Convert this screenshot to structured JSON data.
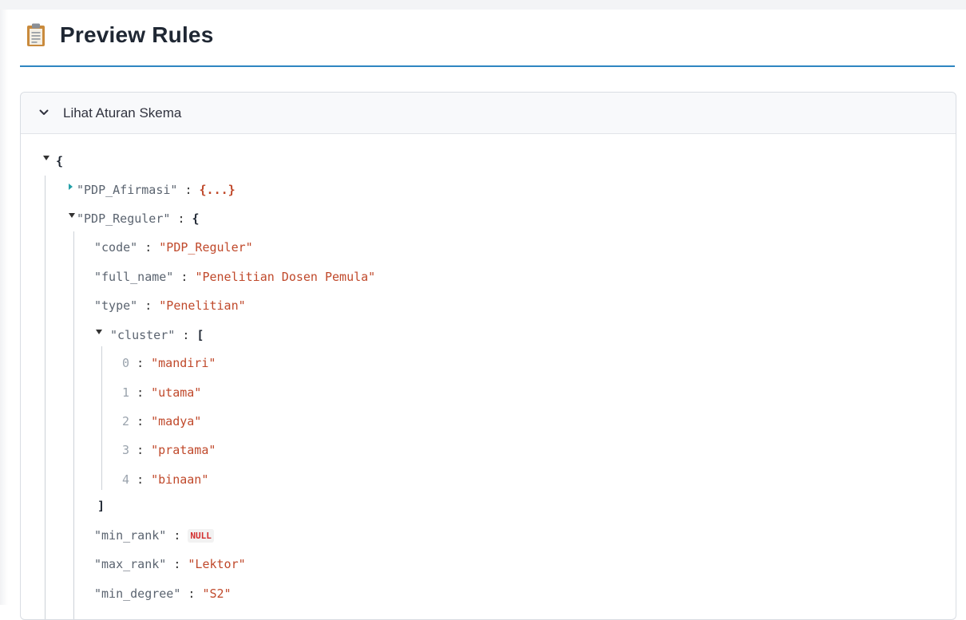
{
  "page": {
    "title": "Preview Rules",
    "icon": "clipboard-icon"
  },
  "expander": {
    "label": "Lihat Aturan Skema",
    "icon": "chevron-down-icon"
  },
  "json": {
    "open_brace": "{",
    "afirmasi_key": "\"PDP_Afirmasi\"",
    "afirmasi_collapsed": "{...}",
    "reguler_key": "\"PDP_Reguler\"",
    "reguler_open": "{",
    "colon": ":",
    "code_key": "\"code\"",
    "code_val": "\"PDP_Reguler\"",
    "full_name_key": "\"full_name\"",
    "full_name_val": "\"Penelitian Dosen Pemula\"",
    "type_key": "\"type\"",
    "type_val": "\"Penelitian\"",
    "cluster_key": "\"cluster\"",
    "cluster_open": "[",
    "cluster_items": [
      {
        "index": "0",
        "value": "\"mandiri\""
      },
      {
        "index": "1",
        "value": "\"utama\""
      },
      {
        "index": "2",
        "value": "\"madya\""
      },
      {
        "index": "3",
        "value": "\"pratama\""
      },
      {
        "index": "4",
        "value": "\"binaan\""
      }
    ],
    "cluster_close": "]",
    "min_rank_key": "\"min_rank\"",
    "min_rank_val": "NULL",
    "max_rank_key": "\"max_rank\"",
    "max_rank_val": "\"Lektor\"",
    "min_degree_key": "\"min_degree\"",
    "min_degree_val": "\"S2\""
  }
}
